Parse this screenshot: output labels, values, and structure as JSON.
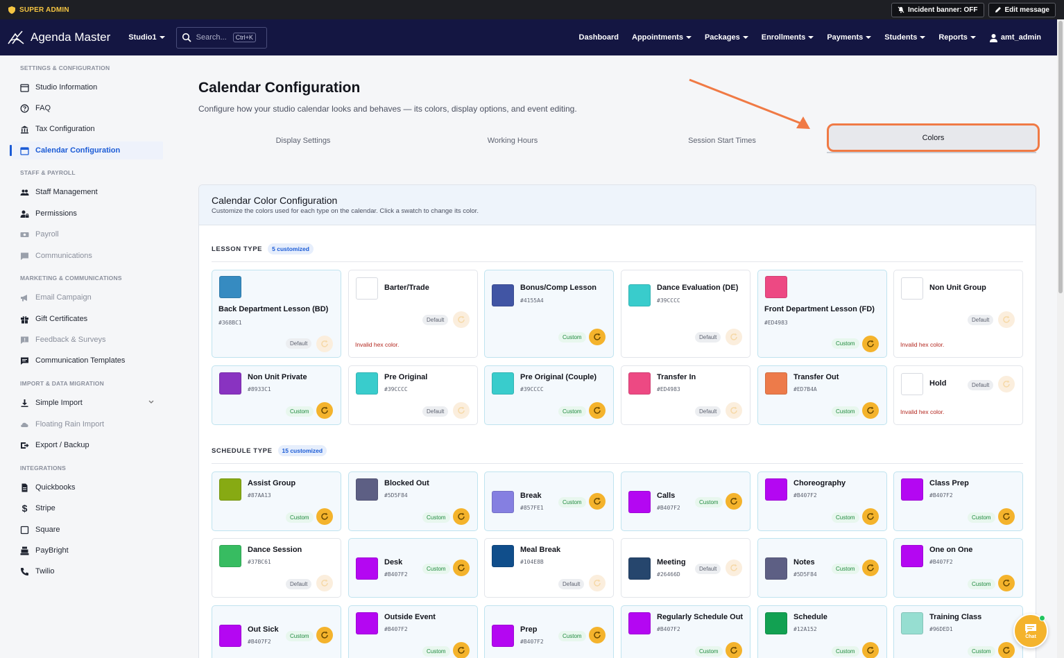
{
  "admin_bar": {
    "role_label": "SUPER ADMIN",
    "incident_banner_label": "Incident banner: OFF",
    "edit_message_label": "Edit message"
  },
  "nav": {
    "brand": "Agenda Master",
    "studio": "Studio1",
    "search_placeholder": "Search...",
    "search_shortcut": "Ctrl+K",
    "links": {
      "dashboard": "Dashboard",
      "appointments": "Appointments",
      "packages": "Packages",
      "enrollments": "Enrollments",
      "payments": "Payments",
      "students": "Students",
      "reports": "Reports",
      "user": "amt_admin"
    }
  },
  "sidebar": {
    "sections": {
      "settings": "SETTINGS & CONFIGURATION",
      "staff": "STAFF & PAYROLL",
      "marketing": "MARKETING & COMMUNICATIONS",
      "import": "IMPORT & DATA MIGRATION",
      "integrations": "INTEGRATIONS"
    },
    "items": {
      "studio_information": "Studio Information",
      "faq": "FAQ",
      "tax_configuration": "Tax Configuration",
      "calendar_configuration": "Calendar Configuration",
      "staff_management": "Staff Management",
      "permissions": "Permissions",
      "payroll": "Payroll",
      "communications": "Communications",
      "email_campaign": "Email Campaign",
      "gift_certificates": "Gift Certificates",
      "feedback_surveys": "Feedback & Surveys",
      "communication_templates": "Communication Templates",
      "simple_import": "Simple Import",
      "floating_rain_import": "Floating Rain Import",
      "export_backup": "Export / Backup",
      "quickbooks": "Quickbooks",
      "stripe": "Stripe",
      "square": "Square",
      "paybright": "PayBright",
      "twilio": "Twilio"
    }
  },
  "page": {
    "title": "Calendar Configuration",
    "subtitle": "Configure how your studio calendar looks and behaves — its colors, display options, and event editing.",
    "tabs": {
      "display": "Display Settings",
      "hours": "Working Hours",
      "start_times": "Session Start Times",
      "colors": "Colors"
    }
  },
  "panel": {
    "title": "Calendar Color Configuration",
    "description": "Customize the colors used for each type on the calendar. Click a swatch to change its color.",
    "lesson_section": {
      "label": "LESSON TYPE",
      "badge": "5 customized"
    },
    "schedule_section": {
      "label": "SCHEDULE TYPE",
      "badge": "15 customized"
    }
  },
  "labels": {
    "custom": "Custom",
    "default": "Default",
    "invalid": "Invalid hex color."
  },
  "lesson_types": {
    "bd": {
      "name": "Back Department Lesson (BD)",
      "hex": "#368BC1",
      "color": "#368BC1"
    },
    "barter": {
      "name": "Barter/Trade"
    },
    "bonus": {
      "name": "Bonus/Comp Lesson",
      "hex": "#4155A4",
      "color": "#4155A4"
    },
    "de": {
      "name": "Dance Evaluation (DE)",
      "hex": "#39CCCC",
      "color": "#39CCCC"
    },
    "fd": {
      "name": "Front Department Lesson (FD)",
      "hex": "#ED4983",
      "color": "#ED4983"
    },
    "nug": {
      "name": "Non Unit Group"
    },
    "nup": {
      "name": "Non Unit Private",
      "hex": "#8933C1",
      "color": "#8933C1"
    },
    "po": {
      "name": "Pre Original",
      "hex": "#39CCCC",
      "color": "#39CCCC"
    },
    "poc": {
      "name": "Pre Original (Couple)",
      "hex": "#39CCCC",
      "color": "#39CCCC"
    },
    "tin": {
      "name": "Transfer In",
      "hex": "#ED4983",
      "color": "#ED4983"
    },
    "tout": {
      "name": "Transfer Out",
      "hex": "#ED7B4A",
      "color": "#ED7B4A"
    },
    "hold": {
      "name": "Hold"
    }
  },
  "schedule_types": {
    "assist": {
      "name": "Assist Group",
      "hex": "#87AA13",
      "color": "#87AA13"
    },
    "blocked": {
      "name": "Blocked Out",
      "hex": "#5D5F84",
      "color": "#5D5F84"
    },
    "break": {
      "name": "Break",
      "hex": "#857FE1",
      "color": "#857FE1"
    },
    "calls": {
      "name": "Calls",
      "hex": "#B407F2",
      "color": "#B407F2"
    },
    "choreo": {
      "name": "Choreography",
      "hex": "#B407F2",
      "color": "#B407F2"
    },
    "classprep": {
      "name": "Class Prep",
      "hex": "#B407F2",
      "color": "#B407F2"
    },
    "dance": {
      "name": "Dance Session",
      "hex": "#37BC61",
      "color": "#37BC61"
    },
    "desk": {
      "name": "Desk",
      "hex": "#B407F2",
      "color": "#B407F2"
    },
    "meal": {
      "name": "Meal Break",
      "hex": "#104E8B",
      "color": "#104E8B"
    },
    "meeting": {
      "name": "Meeting",
      "hex": "#26466D",
      "color": "#26466D"
    },
    "notes": {
      "name": "Notes",
      "hex": "#5D5F84",
      "color": "#5D5F84"
    },
    "oneonone": {
      "name": "One on One",
      "hex": "#B407F2",
      "color": "#B407F2"
    },
    "outsick": {
      "name": "Out Sick",
      "hex": "#B407F2",
      "color": "#B407F2"
    },
    "outside": {
      "name": "Outside Event",
      "hex": "#B407F2",
      "color": "#B407F2"
    },
    "prep": {
      "name": "Prep",
      "hex": "#B407F2",
      "color": "#B407F2"
    },
    "regout": {
      "name": "Regularly Schedule Out",
      "hex": "#B407F2",
      "color": "#B407F2"
    },
    "schedule": {
      "name": "Schedule",
      "hex": "#12A152",
      "color": "#12A152"
    },
    "training": {
      "name": "Training Class",
      "hex": "#96DED1",
      "color": "#96DED1"
    }
  },
  "chat": {
    "label": "Chat"
  }
}
